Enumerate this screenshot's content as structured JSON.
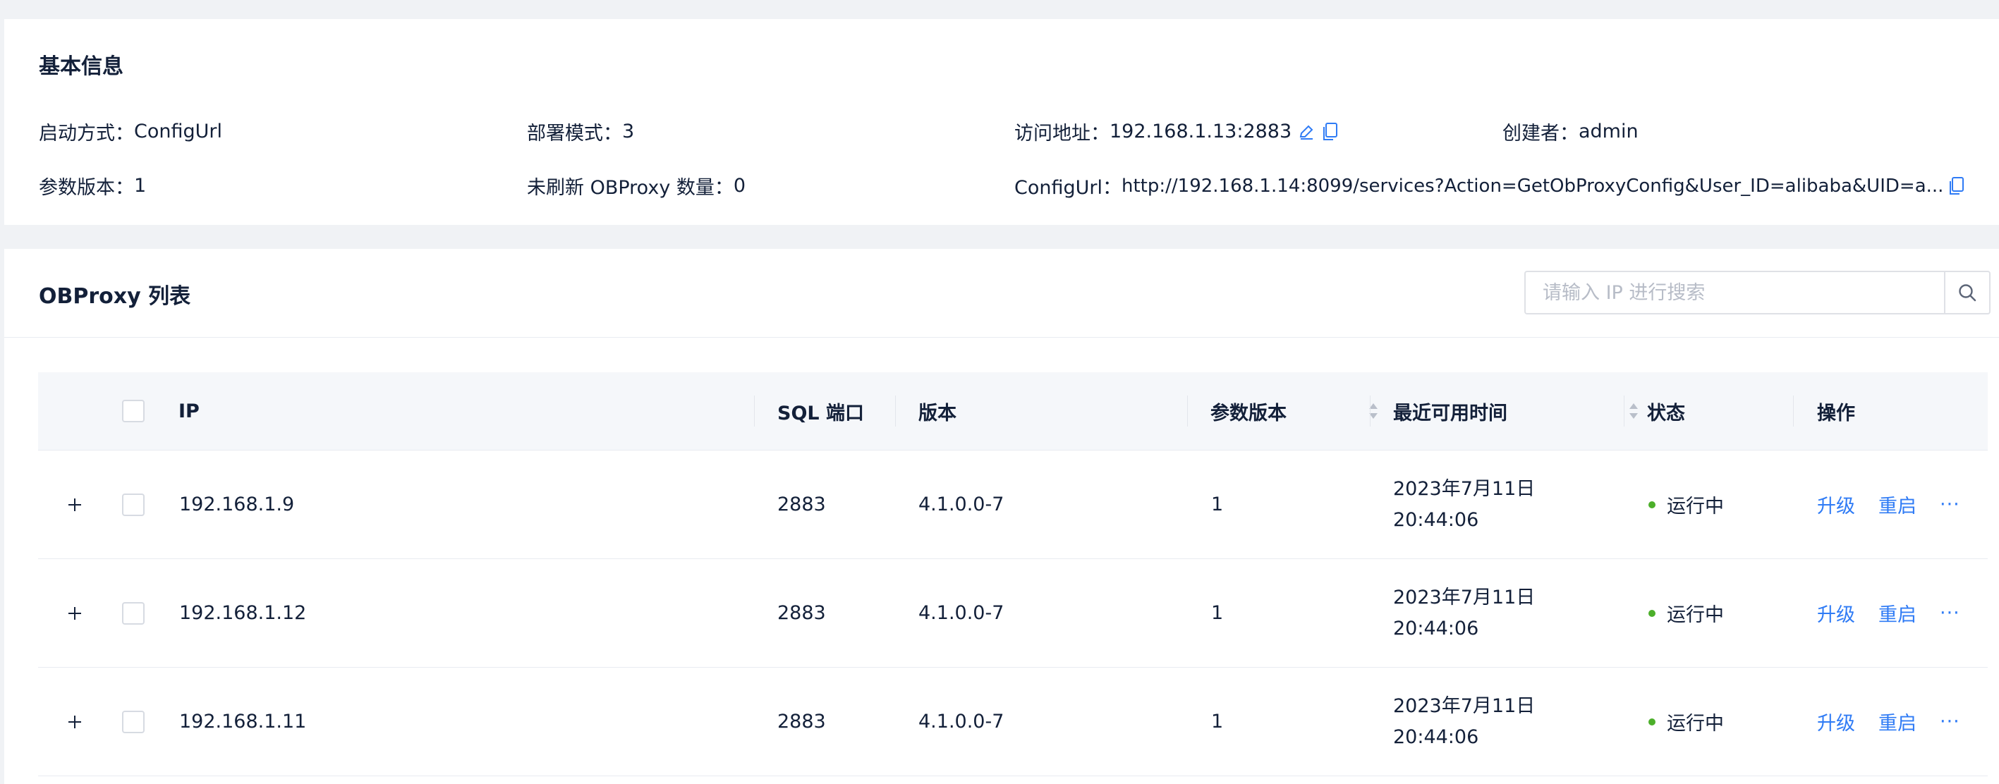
{
  "basic": {
    "title": "基本信息",
    "start_mode_label": "启动方式：",
    "start_mode_value": "ConfigUrl",
    "deploy_mode_label": "部署模式：",
    "deploy_mode_value": "3",
    "access_label": "访问地址：",
    "access_value": "192.168.1.13:2883",
    "creator_label": "创建者：",
    "creator_value": "admin",
    "param_version_label": "参数版本：",
    "param_version_value": "1",
    "unrefreshed_label": "未刷新 OBProxy 数量：",
    "unrefreshed_value": "0",
    "configurl_label": "ConfigUrl：",
    "configurl_value": "http://192.168.1.14:8099/services?Action=GetObProxyConfig&User_ID=alibaba&UID=a..."
  },
  "list": {
    "title": "OBProxy 列表",
    "search_placeholder": "请输入 IP 进行搜索",
    "columns": {
      "ip": "IP",
      "sql_port": "SQL 端口",
      "version": "版本",
      "param_version": "参数版本",
      "last_available": "最近可用时间",
      "status": "状态",
      "actions": "操作"
    },
    "rows": [
      {
        "ip": "192.168.1.9",
        "sql_port": "2883",
        "version": "4.1.0.0-7",
        "param_version": "1",
        "date": "2023年7月11日",
        "time": "20:44:06",
        "status": "运行中"
      },
      {
        "ip": "192.168.1.12",
        "sql_port": "2883",
        "version": "4.1.0.0-7",
        "param_version": "1",
        "date": "2023年7月11日",
        "time": "20:44:06",
        "status": "运行中"
      },
      {
        "ip": "192.168.1.11",
        "sql_port": "2883",
        "version": "4.1.0.0-7",
        "param_version": "1",
        "date": "2023年7月11日",
        "time": "20:44:06",
        "status": "运行中"
      }
    ],
    "action_upgrade": "升级",
    "action_restart": "重启",
    "action_more": "···"
  },
  "colors": {
    "link": "#2f7bf5",
    "status_running": "#4caf2a",
    "text": "#132039",
    "page_bg": "#f0f2f5"
  },
  "icons": [
    "edit-icon",
    "copy-icon",
    "search-icon",
    "expand-plus-icon",
    "sort-icon"
  ]
}
